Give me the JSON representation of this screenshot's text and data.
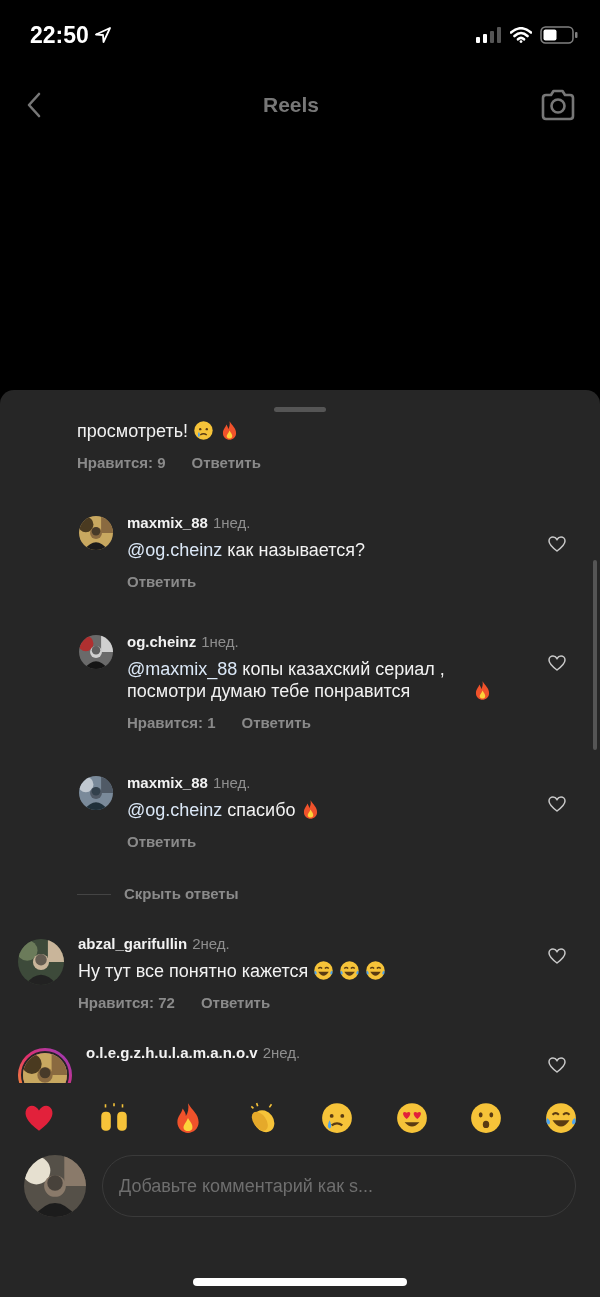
{
  "status_bar": {
    "time": "22:50"
  },
  "nav": {
    "title": "Reels"
  },
  "comments": [
    {
      "kind": "fragment",
      "text": "просмотреть!",
      "emojis": [
        {
          "kind": "crying"
        },
        {
          "kind": "fire"
        }
      ],
      "likes": "Нравится: 9",
      "reply": "Ответить"
    },
    {
      "kind": "reply",
      "username": "maxmix_88",
      "time": "1нед.",
      "mention": "@og.cheinz",
      "text": " как называется?",
      "reply": "Ответить",
      "has_story": false
    },
    {
      "kind": "reply",
      "username": "og.cheinz",
      "time": "1нед.",
      "mention": "@maxmix_88",
      "text": " копы казахский сериал , посмотри думаю тебе понравится",
      "emojis": [
        {
          "kind": "fire"
        }
      ],
      "likes": "Нравится: 1",
      "reply": "Ответить",
      "has_story": false
    },
    {
      "kind": "reply",
      "username": "maxmix_88",
      "time": "1нед.",
      "mention": "@og.cheinz",
      "text": " спасибо",
      "emojis": [
        {
          "kind": "fire"
        }
      ],
      "reply": "Ответить",
      "has_story": false
    },
    {
      "kind": "toggle",
      "label": "Скрыть ответы"
    },
    {
      "kind": "comment",
      "username": "abzal_garifullin",
      "time": "2нед.",
      "text": "Ну тут все понятно кажется",
      "emojis": [
        {
          "kind": "joy"
        },
        {
          "kind": "joy"
        },
        {
          "kind": "joy"
        }
      ],
      "likes": "Нравится: 72",
      "reply": "Ответить",
      "has_story": false
    },
    {
      "kind": "comment",
      "username": "o.l.e.g.z.h.u.l.a.m.a.n.o.v",
      "time": "2нед.",
      "has_story": true
    }
  ],
  "reactions": [
    {
      "kind": "heart"
    },
    {
      "kind": "raised_hands"
    },
    {
      "kind": "fire"
    },
    {
      "kind": "clap"
    },
    {
      "kind": "crying"
    },
    {
      "kind": "heart_eyes"
    },
    {
      "kind": "surprised"
    },
    {
      "kind": "joy"
    }
  ],
  "composer": {
    "placeholder": "Добавьте комментарий как s..."
  }
}
